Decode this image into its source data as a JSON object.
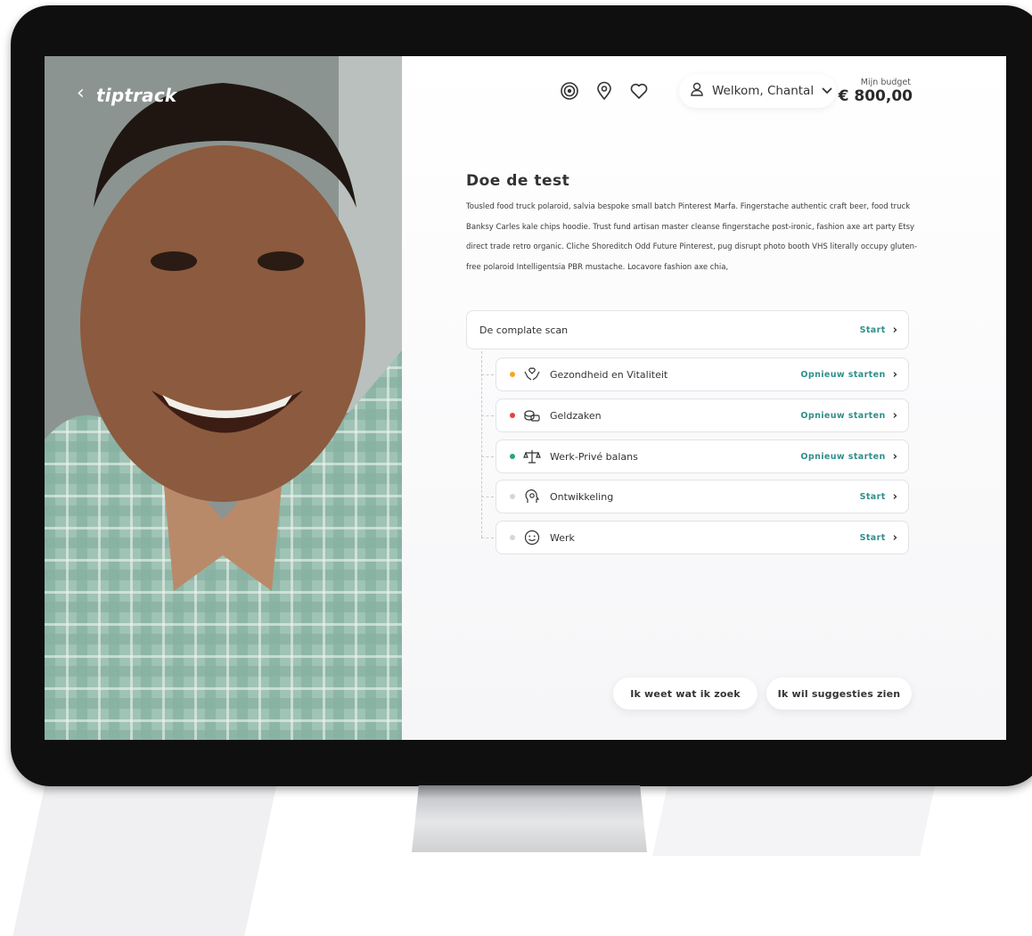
{
  "sidebar": {
    "back_icon": "chevron-left-icon",
    "logo": "tiptrack"
  },
  "topbar": {
    "icons": [
      "target-icon",
      "location-pin-icon",
      "heart-icon"
    ],
    "user_label": "Welkom, Chantal",
    "budget_label": "Mijn budget",
    "budget_value": "€ 800,00"
  },
  "main": {
    "title": "Doe de test",
    "description": "Tousled food truck polaroid, salvia bespoke small batch Pinterest Marfa. Fingerstache authentic craft beer, food truck Banksy Carles kale chips hoodie. Trust fund artisan master cleanse fingerstache post-ironic, fashion axe art party Etsy direct trade retro organic. Cliche Shoreditch Odd Future Pinterest, pug disrupt photo booth VHS literally occupy gluten-free polaroid Intelligentsia PBR mustache. Locavore fashion axe chia,",
    "scan": {
      "label": "De complate scan",
      "action": "Start"
    },
    "items": [
      {
        "label": "Gezondheid en Vitaliteit",
        "action": "Opnieuw starten",
        "status_color": "#f5a623",
        "icon": "hands-heart-icon"
      },
      {
        "label": "Geldzaken",
        "action": "Opnieuw starten",
        "status_color": "#e8403a",
        "icon": "coins-icon"
      },
      {
        "label": "Werk-Privé balans",
        "action": "Opnieuw starten",
        "status_color": "#2aa47a",
        "icon": "balance-scale-icon"
      },
      {
        "label": "Ontwikkeling",
        "action": "Start",
        "status_color": "#d6d6d9",
        "icon": "head-gear-icon"
      },
      {
        "label": "Werk",
        "action": "Start",
        "status_color": "#d6d6d9",
        "icon": "smiley-icon"
      }
    ]
  },
  "footer": {
    "btn_search": "Ik weet wat ik zoek",
    "btn_suggestions": "Ik wil suggesties zien"
  },
  "colors": {
    "accent": "#2f8f8a",
    "text": "#333333"
  }
}
